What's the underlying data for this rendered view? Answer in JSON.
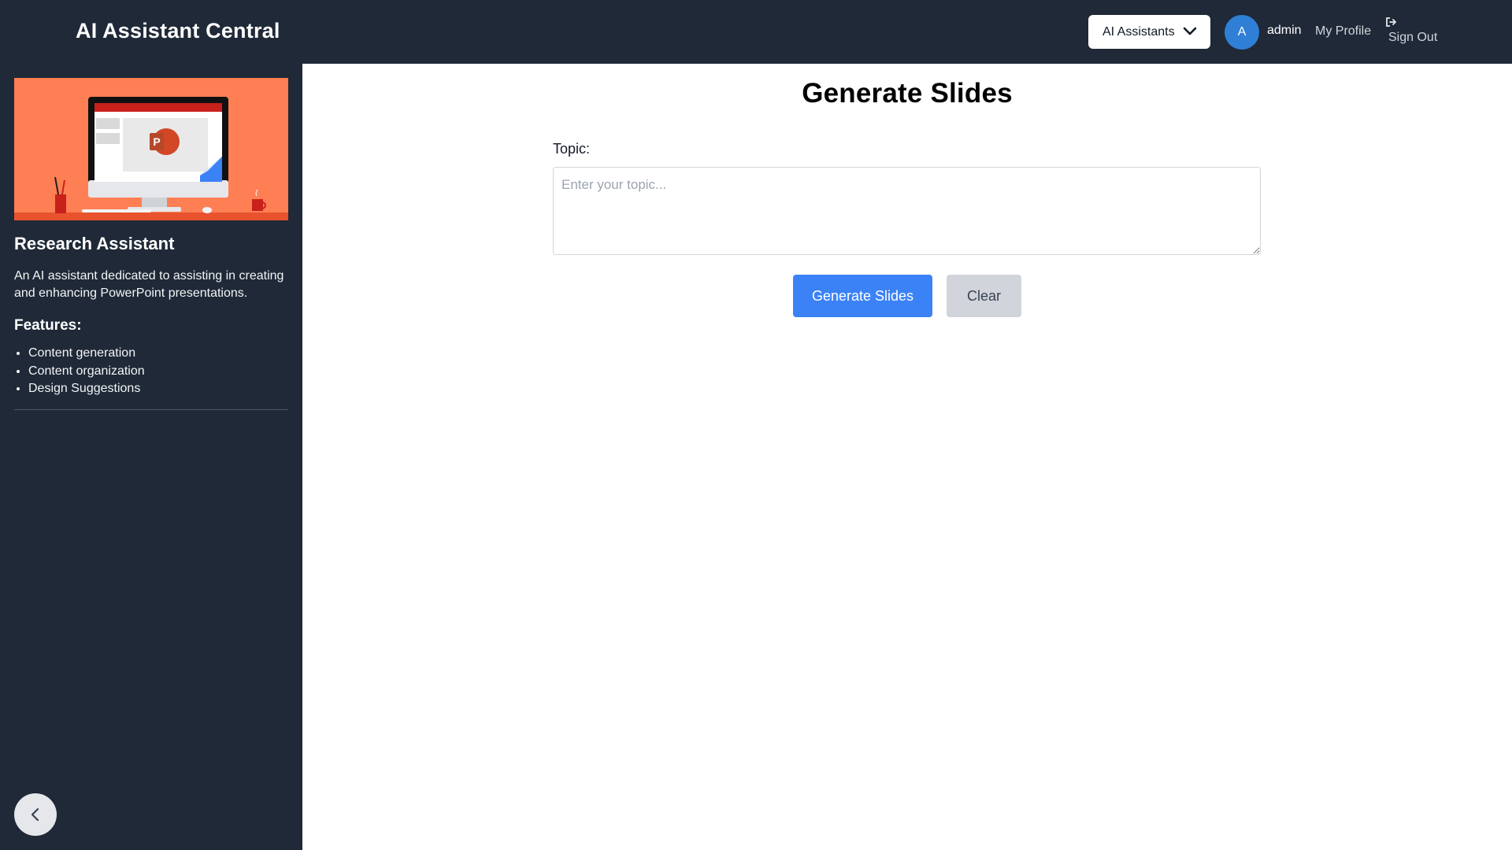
{
  "header": {
    "app_title": "AI Assistant Central",
    "assistants_dropdown_label": "AI Assistants",
    "avatar_initial": "A",
    "username": "admin",
    "my_profile_label": "My Profile",
    "sign_out_label": "Sign Out"
  },
  "sidebar": {
    "assistant_name": "Research Assistant",
    "description": "An AI assistant dedicated to assisting in creating and enhancing PowerPoint presentations.",
    "features_heading": "Features:",
    "features": [
      "Content generation",
      "Content organization",
      "Design Suggestions"
    ]
  },
  "main": {
    "page_title": "Generate Slides",
    "topic_label": "Topic:",
    "topic_placeholder": "Enter your topic...",
    "topic_value": "",
    "generate_button_label": "Generate Slides",
    "clear_button_label": "Clear"
  },
  "colors": {
    "header_bg": "#1f2937",
    "sidebar_bg": "#1f2937",
    "hero_bg": "#ff7f55",
    "primary_button": "#3b82f6",
    "secondary_button": "#d1d5db",
    "avatar_bg": "#2f7fd6"
  },
  "icons": {
    "dropdown": "chevron-down-icon",
    "sign_out": "sign-out-icon",
    "collapse": "chevron-left-icon"
  }
}
